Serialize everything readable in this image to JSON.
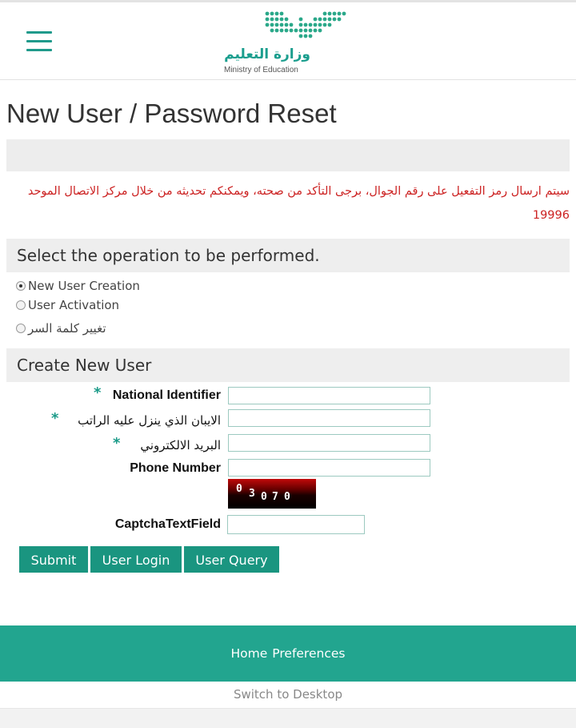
{
  "header": {
    "logo_arabic": "وزارة التعليم",
    "logo_english": "Ministry of Education",
    "brand_color": "#1f9a8b"
  },
  "page": {
    "title": "New User / Password Reset",
    "notice": "سيتم ارسال رمز التفعيل على رقم الجوال، برجى التأكد من صحته، ويمكنكم تحديثه من خلال مركز الاتصال الموحد 19996",
    "notice_color": "#cc2222"
  },
  "operation": {
    "header": "Select the operation to be performed.",
    "options": [
      {
        "label": "New User Creation",
        "selected": true
      },
      {
        "label": "User Activation",
        "selected": false
      },
      {
        "label": "تغيير كلمة السر",
        "selected": false
      }
    ]
  },
  "create_user": {
    "header": "Create New User",
    "required_mark": "*",
    "fields": {
      "national_id": {
        "label": "National Identifier",
        "value": ""
      },
      "iban": {
        "label": "الايبان الذي ينزل عليه الراتب",
        "value": ""
      },
      "email": {
        "label": "البريد الالكتروني",
        "value": ""
      },
      "phone": {
        "label": "Phone Number",
        "value": ""
      },
      "captcha": {
        "label": "CaptchaTextField",
        "value": ""
      }
    },
    "captcha_image_text": [
      "0",
      "3",
      "0",
      "7",
      "0"
    ]
  },
  "buttons": {
    "submit": "Submit",
    "user_login": "User Login",
    "user_query": "User Query",
    "button_color": "#1a9580"
  },
  "footer": {
    "home": "Home",
    "preferences": "Preferences",
    "switch": "Switch to Desktop",
    "footer_color": "#22a58f"
  }
}
